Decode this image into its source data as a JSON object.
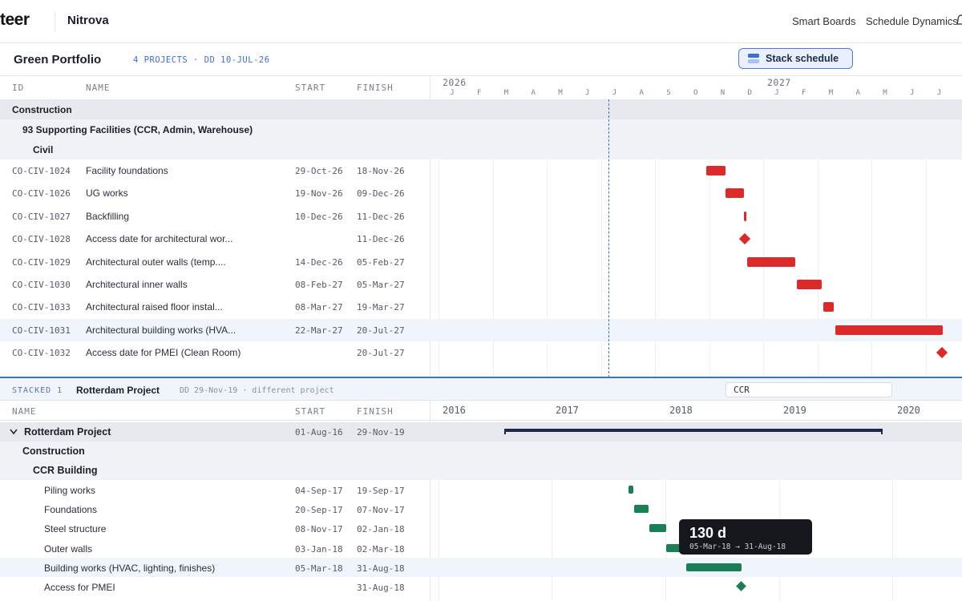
{
  "app": {
    "logo": "teer",
    "workspace": "Nitrova",
    "nav": [
      "Smart Boards",
      "Schedule Dynamics"
    ]
  },
  "portfolio": {
    "title": "Green Portfolio",
    "meta": "4 PROJECTS · DD 10-JUL-26",
    "stack_button": "Stack schedule"
  },
  "top_grid": {
    "columns": {
      "id": "ID",
      "name": "NAME",
      "start": "START",
      "finish": "FINISH"
    },
    "years": [
      "2026",
      "2027"
    ],
    "months": [
      "J",
      "F",
      "M",
      "A",
      "M",
      "J",
      "J",
      "A",
      "S",
      "O",
      "N",
      "D",
      "J",
      "F",
      "M",
      "A",
      "M",
      "J",
      "J"
    ],
    "groups": {
      "level1": "Construction",
      "level2": "93 Supporting Facilities (CCR, Admin, Warehouse)",
      "level3": "Civil"
    },
    "rows": [
      {
        "id": "CO-CIV-1024",
        "name": "Facility foundations",
        "start": "29-Oct-26",
        "finish": "18-Nov-26"
      },
      {
        "id": "CO-CIV-1026",
        "name": "UG works",
        "start": "19-Nov-26",
        "finish": "09-Dec-26"
      },
      {
        "id": "CO-CIV-1027",
        "name": "Backfilling",
        "start": "10-Dec-26",
        "finish": "11-Dec-26"
      },
      {
        "id": "CO-CIV-1028",
        "name": "Access date for architectural wor...",
        "start": "",
        "finish": "11-Dec-26"
      },
      {
        "id": "CO-CIV-1029",
        "name": "Architectural outer walls (temp....",
        "start": "14-Dec-26",
        "finish": "05-Feb-27"
      },
      {
        "id": "CO-CIV-1030",
        "name": "Architectural inner walls",
        "start": "08-Feb-27",
        "finish": "05-Mar-27"
      },
      {
        "id": "CO-CIV-1033",
        "name": "Architectural raised floor instal...",
        "start": "08-Mar-27",
        "finish": "19-Mar-27"
      },
      {
        "id": "CO-CIV-1031",
        "name": "Architectural building works (HVA...",
        "start": "22-Mar-27",
        "finish": "20-Jul-27"
      },
      {
        "id": "CO-CIV-1032",
        "name": "Access date for PMEI (Clean Room)",
        "start": "",
        "finish": "20-Jul-27"
      }
    ]
  },
  "stacked": {
    "tag": "STACKED 1",
    "name": "Rotterdam Project",
    "meta": "DD 29-Nov-19 · different project",
    "filter": "CCR",
    "columns": {
      "name": "NAME",
      "start": "START",
      "finish": "FINISH"
    },
    "years": [
      "2016",
      "2017",
      "2018",
      "2019",
      "2020"
    ],
    "project": {
      "name": "Rotterdam Project",
      "start": "01-Aug-16",
      "finish": "29-Nov-19"
    },
    "group1": "Construction",
    "group2": "CCR Building",
    "rows": [
      {
        "name": "Piling works",
        "start": "04-Sep-17",
        "finish": "19-Sep-17"
      },
      {
        "name": "Foundations",
        "start": "20-Sep-17",
        "finish": "07-Nov-17"
      },
      {
        "name": "Steel structure",
        "start": "08-Nov-17",
        "finish": "02-Jan-18"
      },
      {
        "name": "Outer walls",
        "start": "03-Jan-18",
        "finish": "02-Mar-18"
      },
      {
        "name": "Building works (HVAC, lighting, finishes)",
        "start": "05-Mar-18",
        "finish": "31-Aug-18"
      },
      {
        "name": "Access for PMEI",
        "start": "",
        "finish": "31-Aug-18"
      }
    ],
    "tooltip": {
      "value": "130 d",
      "range": "05-Mar-18 → 31-Aug-18"
    }
  },
  "colors": {
    "accent": "#3a6fd8",
    "task_bar": "#dc2a2a",
    "stacked_bar": "#1a7f55",
    "summary_bar": "#1c2a4a"
  }
}
